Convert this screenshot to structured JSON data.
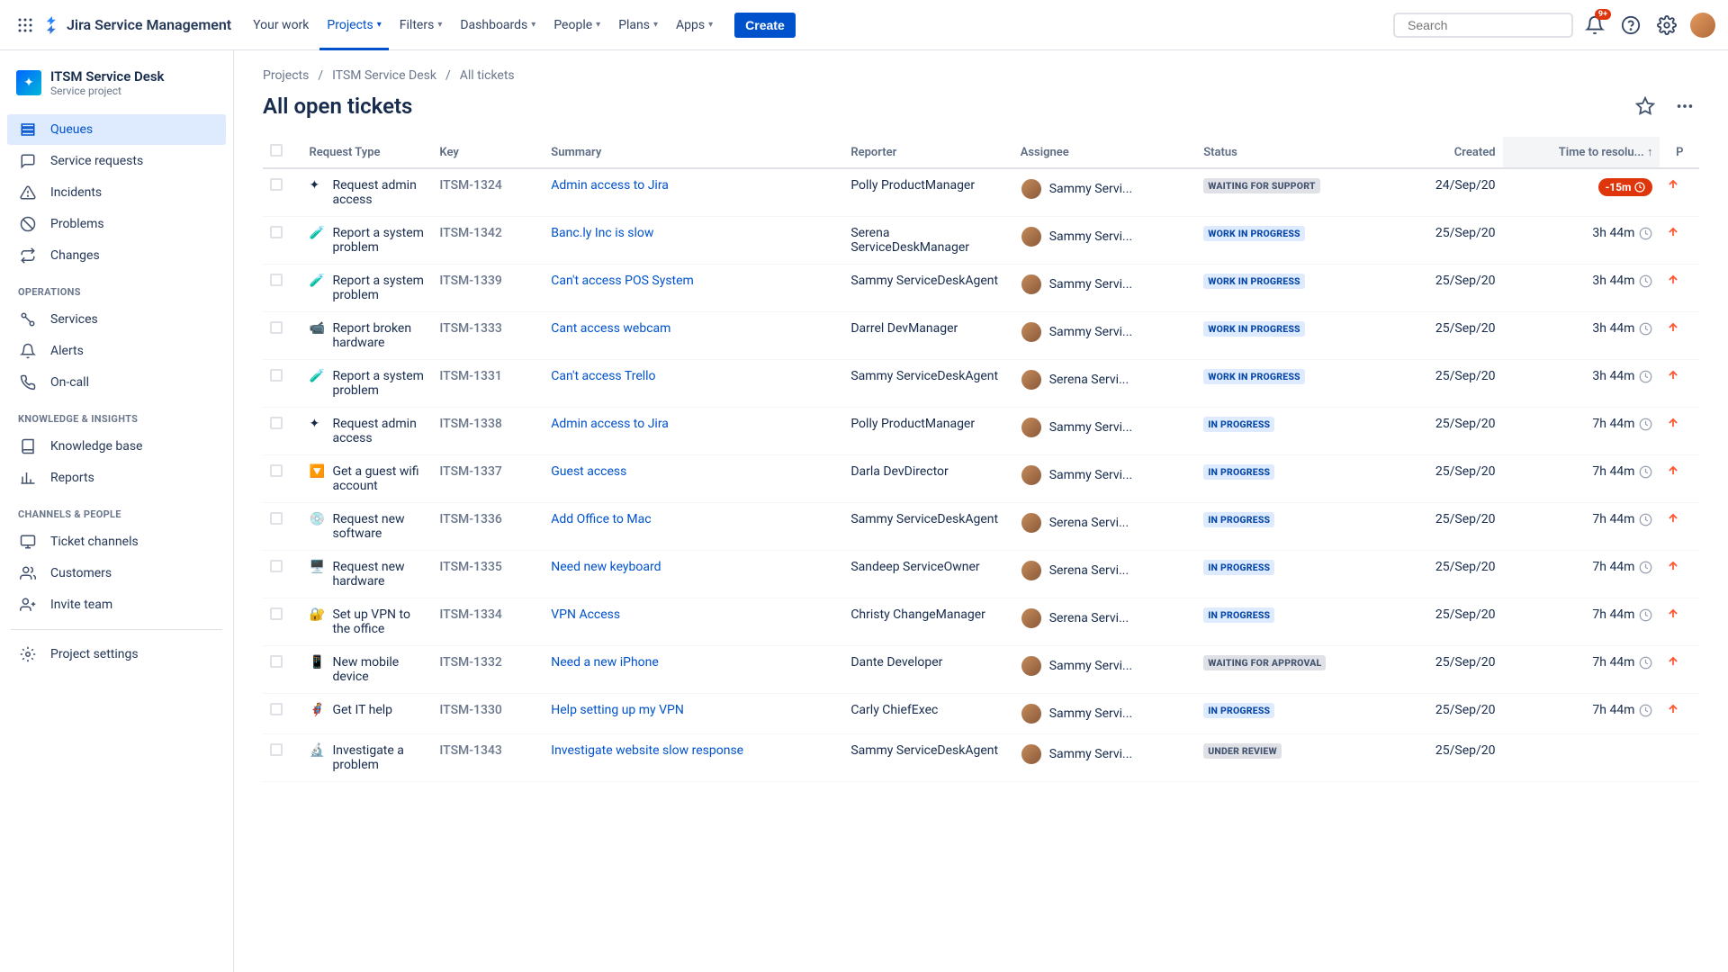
{
  "header": {
    "product_name": "Jira Service Management",
    "nav": [
      "Your work",
      "Projects",
      "Filters",
      "Dashboards",
      "People",
      "Plans",
      "Apps"
    ],
    "nav_nochevron_idx": 0,
    "active_nav": "Projects",
    "create_label": "Create",
    "search_placeholder": "Search",
    "notification_badge": "9+"
  },
  "sidebar": {
    "project_name": "ITSM Service Desk",
    "project_sub": "Service project",
    "groups": [
      {
        "label": null,
        "items": [
          {
            "icon": "queues",
            "label": "Queues",
            "active": true
          },
          {
            "icon": "comment",
            "label": "Service requests"
          },
          {
            "icon": "alert-triangle",
            "label": "Incidents"
          },
          {
            "icon": "block",
            "label": "Problems"
          },
          {
            "icon": "swap",
            "label": "Changes"
          }
        ]
      },
      {
        "label": "OPERATIONS",
        "items": [
          {
            "icon": "connect",
            "label": "Services"
          },
          {
            "icon": "bell",
            "label": "Alerts"
          },
          {
            "icon": "phone",
            "label": "On-call"
          }
        ]
      },
      {
        "label": "KNOWLEDGE & INSIGHTS",
        "items": [
          {
            "icon": "book",
            "label": "Knowledge base"
          },
          {
            "icon": "chart",
            "label": "Reports"
          }
        ]
      },
      {
        "label": "CHANNELS & PEOPLE",
        "items": [
          {
            "icon": "monitor",
            "label": "Ticket channels"
          },
          {
            "icon": "users",
            "label": "Customers"
          },
          {
            "icon": "user-plus",
            "label": "Invite team"
          }
        ]
      }
    ],
    "settings_label": "Project settings"
  },
  "content": {
    "breadcrumbs": [
      "Projects",
      "ITSM Service Desk",
      "All tickets"
    ],
    "title": "All open tickets",
    "columns": [
      "",
      "Request Type",
      "Key",
      "Summary",
      "Reporter",
      "Assignee",
      "Status",
      "Created",
      "Time to resolu...",
      "P"
    ],
    "sort_col": "Time to resolu...",
    "sort_dir": "up",
    "rows": [
      {
        "req_icon": "✦",
        "req_type": "Request admin access",
        "key": "ITSM-1324",
        "summary": "Admin access to Jira",
        "reporter": "Polly ProductManager",
        "assignee": "Sammy Servi...",
        "status": "WAITING FOR SUPPORT",
        "status_kind": "default",
        "created": "24/Sep/20",
        "time": "-15m",
        "time_breached": true,
        "priority": "high"
      },
      {
        "req_icon": "🧪",
        "req_type": "Report a system problem",
        "key": "ITSM-1342",
        "summary": "Banc.ly Inc is slow",
        "reporter": "Serena ServiceDeskManager",
        "assignee": "Sammy Servi...",
        "status": "WORK IN PROGRESS",
        "status_kind": "inprogress",
        "created": "25/Sep/20",
        "time": "3h 44m",
        "time_breached": false,
        "priority": "high"
      },
      {
        "req_icon": "🧪",
        "req_type": "Report a system problem",
        "key": "ITSM-1339",
        "summary": "Can't access POS System",
        "reporter": "Sammy ServiceDeskAgent",
        "assignee": "Sammy Servi...",
        "status": "WORK IN PROGRESS",
        "status_kind": "inprogress",
        "created": "25/Sep/20",
        "time": "3h 44m",
        "time_breached": false,
        "priority": "high"
      },
      {
        "req_icon": "📹",
        "req_type": "Report broken hardware",
        "key": "ITSM-1333",
        "summary": "Cant access webcam",
        "reporter": "Darrel DevManager",
        "assignee": "Sammy Servi...",
        "status": "WORK IN PROGRESS",
        "status_kind": "inprogress",
        "created": "25/Sep/20",
        "time": "3h 44m",
        "time_breached": false,
        "priority": "high"
      },
      {
        "req_icon": "🧪",
        "req_type": "Report a system problem",
        "key": "ITSM-1331",
        "summary": "Can't access Trello",
        "reporter": "Sammy ServiceDeskAgent",
        "assignee": "Serena Servi...",
        "status": "WORK IN PROGRESS",
        "status_kind": "inprogress",
        "created": "25/Sep/20",
        "time": "3h 44m",
        "time_breached": false,
        "priority": "high"
      },
      {
        "req_icon": "✦",
        "req_type": "Request admin access",
        "key": "ITSM-1338",
        "summary": "Admin access to Jira",
        "reporter": "Polly ProductManager",
        "assignee": "Sammy Servi...",
        "status": "IN PROGRESS",
        "status_kind": "inprogress",
        "created": "25/Sep/20",
        "time": "7h 44m",
        "time_breached": false,
        "priority": "high"
      },
      {
        "req_icon": "🔽",
        "req_type": "Get a guest wifi account",
        "key": "ITSM-1337",
        "summary": "Guest access",
        "reporter": "Darla DevDirector",
        "assignee": "Sammy Servi...",
        "status": "IN PROGRESS",
        "status_kind": "inprogress",
        "created": "25/Sep/20",
        "time": "7h 44m",
        "time_breached": false,
        "priority": "high"
      },
      {
        "req_icon": "💿",
        "req_type": "Request new software",
        "key": "ITSM-1336",
        "summary": "Add Office to Mac",
        "reporter": "Sammy ServiceDeskAgent",
        "assignee": "Serena Servi...",
        "status": "IN PROGRESS",
        "status_kind": "inprogress",
        "created": "25/Sep/20",
        "time": "7h 44m",
        "time_breached": false,
        "priority": "high"
      },
      {
        "req_icon": "🖥️",
        "req_type": "Request new hardware",
        "key": "ITSM-1335",
        "summary": "Need new keyboard",
        "reporter": "Sandeep ServiceOwner",
        "assignee": "Serena Servi...",
        "status": "IN PROGRESS",
        "status_kind": "inprogress",
        "created": "25/Sep/20",
        "time": "7h 44m",
        "time_breached": false,
        "priority": "high"
      },
      {
        "req_icon": "🔐",
        "req_type": "Set up VPN to the office",
        "key": "ITSM-1334",
        "summary": "VPN Access",
        "reporter": "Christy ChangeManager",
        "assignee": "Serena Servi...",
        "status": "IN PROGRESS",
        "status_kind": "inprogress",
        "created": "25/Sep/20",
        "time": "7h 44m",
        "time_breached": false,
        "priority": "high"
      },
      {
        "req_icon": "📱",
        "req_type": "New mobile device",
        "key": "ITSM-1332",
        "summary": "Need a new iPhone",
        "reporter": "Dante Developer",
        "assignee": "Sammy Servi...",
        "status": "WAITING FOR APPROVAL",
        "status_kind": "default",
        "created": "25/Sep/20",
        "time": "7h 44m",
        "time_breached": false,
        "priority": "high"
      },
      {
        "req_icon": "🦸",
        "req_type": "Get IT help",
        "key": "ITSM-1330",
        "summary": "Help setting up my VPN",
        "reporter": "Carly ChiefExec",
        "assignee": "Sammy Servi...",
        "status": "IN PROGRESS",
        "status_kind": "inprogress",
        "created": "25/Sep/20",
        "time": "7h 44m",
        "time_breached": false,
        "priority": "high"
      },
      {
        "req_icon": "🔬",
        "req_type": "Investigate a problem",
        "key": "ITSM-1343",
        "summary": "Investigate website slow response",
        "reporter": "Sammy ServiceDeskAgent",
        "assignee": "Sammy Servi...",
        "status": "UNDER REVIEW",
        "status_kind": "default",
        "created": "25/Sep/20",
        "time": "",
        "time_breached": false,
        "priority": ""
      }
    ]
  }
}
